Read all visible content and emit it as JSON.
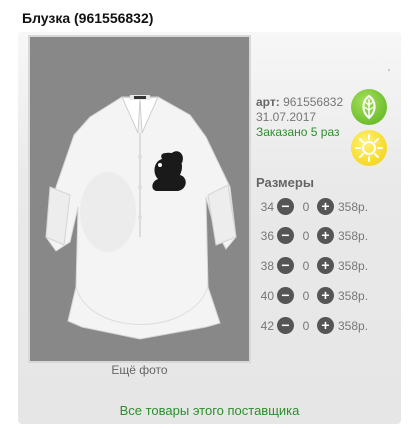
{
  "product": {
    "title": "Блузка (961556832)",
    "art_label": "арт:",
    "art_value": "961556832",
    "date": "31.07.2017",
    "ordered": "Заказано 5 раз"
  },
  "photo": {
    "more_label": "Ещё фото",
    "tick": "'"
  },
  "badges": {
    "eco_icon": "leaf-icon",
    "sun_icon": "sun-icon"
  },
  "sizes": {
    "title": "Размеры",
    "rows": [
      {
        "size": "34",
        "qty": "0",
        "price": "358р."
      },
      {
        "size": "36",
        "qty": "0",
        "price": "358р."
      },
      {
        "size": "38",
        "qty": "0",
        "price": "358р."
      },
      {
        "size": "40",
        "qty": "0",
        "price": "358р."
      },
      {
        "size": "42",
        "qty": "0",
        "price": "358р."
      }
    ],
    "minus_glyph": "−",
    "plus_glyph": "+"
  },
  "footer": {
    "all_goods": "Все товары этого поставщика"
  },
  "colors": {
    "accent_green": "#2b8f2b",
    "photo_bg": "#888888"
  }
}
